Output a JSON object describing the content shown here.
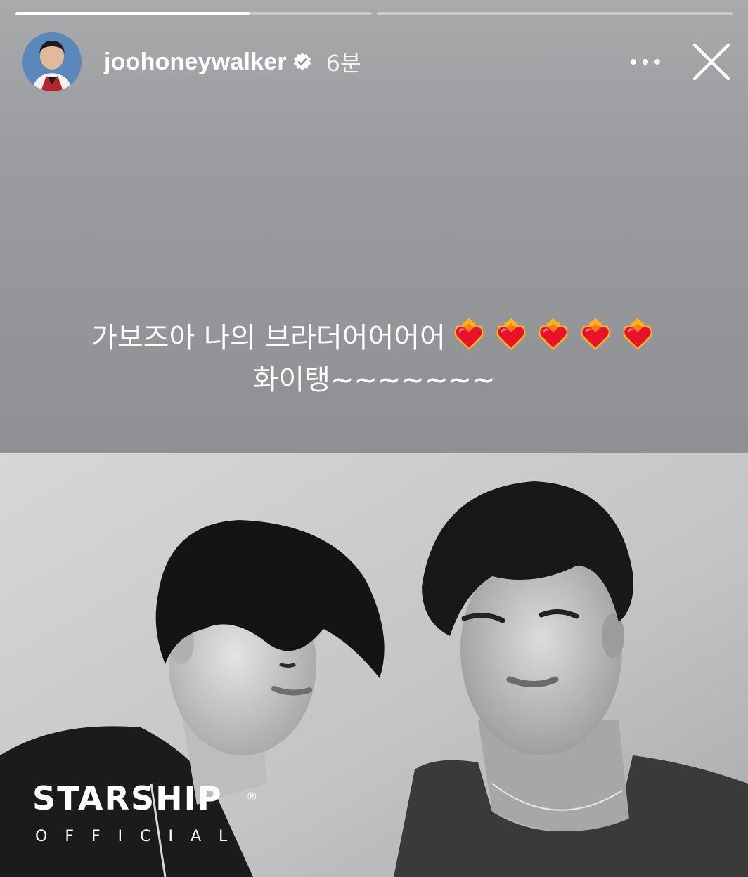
{
  "story": {
    "progress_segments": [
      {
        "filled": 0.66
      },
      {
        "filled": 0.0
      }
    ]
  },
  "header": {
    "username": "joohoneywalker",
    "verified": true,
    "timestamp": "6분",
    "avatar_icon": "profile-photo",
    "more_icon": "more-horizontal-icon",
    "close_icon": "close-icon"
  },
  "caption": {
    "line1": "가보즈아 나의 브라더어어어어",
    "hearts": [
      "❤️‍🔥",
      "❤️‍🔥",
      "❤️‍🔥",
      "❤️‍🔥",
      "❤️‍🔥"
    ],
    "line2": "화이탱~~~~~~~"
  },
  "photo": {
    "logo_word": "STARSHIP",
    "logo_registered": "®",
    "logo_sub": "OFFICIAL"
  },
  "colors": {
    "text": "#ffffff",
    "upper_bg": "#9a9b9e",
    "progress_track": "rgba(255,255,255,0.38)"
  }
}
